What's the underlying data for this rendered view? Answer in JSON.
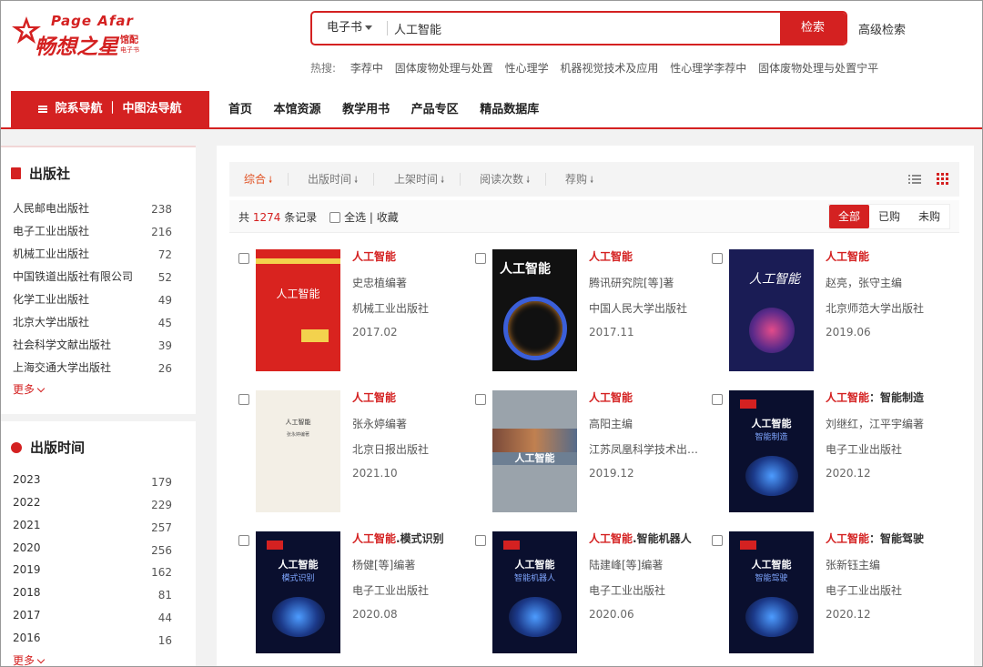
{
  "logo": {
    "brand_en": "Page Afar",
    "brand_cn": "畅想之星",
    "brand_sub_1": "馆配",
    "brand_sub_2": "电子书"
  },
  "search": {
    "category": "电子书",
    "query": "人工智能",
    "button": "检索",
    "advanced": "高级检索"
  },
  "hot": {
    "label": "热搜:",
    "terms": [
      "李荐中",
      "固体废物处理与处置",
      "性心理学",
      "机器视觉技术及应用",
      "性心理学李荐中",
      "固体废物处理与处置宁平"
    ]
  },
  "nav": {
    "category_nav": "院系导航 ｜ 中图法导航",
    "links": [
      "首页",
      "本馆资源",
      "教学用书",
      "产品专区",
      "精品数据库"
    ]
  },
  "publishers": {
    "title": "出版社",
    "items": [
      {
        "name": "人民邮电出版社",
        "count": "238"
      },
      {
        "name": "电子工业出版社",
        "count": "216"
      },
      {
        "name": "机械工业出版社",
        "count": "72"
      },
      {
        "name": "中国铁道出版社有限公司",
        "count": "52"
      },
      {
        "name": "化学工业出版社",
        "count": "49"
      },
      {
        "name": "北京大学出版社",
        "count": "45"
      },
      {
        "name": "社会科学文献出版社",
        "count": "39"
      },
      {
        "name": "上海交通大学出版社",
        "count": "26"
      }
    ],
    "more": "更多"
  },
  "years": {
    "title": "出版时间",
    "items": [
      {
        "name": "2023",
        "count": "179"
      },
      {
        "name": "2022",
        "count": "229"
      },
      {
        "name": "2021",
        "count": "257"
      },
      {
        "name": "2020",
        "count": "256"
      },
      {
        "name": "2019",
        "count": "162"
      },
      {
        "name": "2018",
        "count": "81"
      },
      {
        "name": "2017",
        "count": "44"
      },
      {
        "name": "2016",
        "count": "16"
      }
    ],
    "more": "更多"
  },
  "sort": {
    "items": [
      "综合",
      "出版时间",
      "上架时间",
      "阅读次数",
      "荐购"
    ]
  },
  "summary": {
    "prefix": "共",
    "count": "1274",
    "suffix": "条记录",
    "select_all": "全选 | 收藏"
  },
  "filter_tabs": [
    "全部",
    "已购",
    "未购"
  ],
  "books": [
    {
      "title": "人工智能",
      "title_rest": "",
      "author": "史忠植编著",
      "publisher": "机械工业出版社",
      "date": "2017.02",
      "cover": "red",
      "cover_text": "人工智能"
    },
    {
      "title": "人工智能",
      "title_rest": "",
      "author": "腾讯研究院[等]著",
      "publisher": "中国人民大学出版社",
      "date": "2017.11",
      "cover": "black",
      "cover_text": "人工智能"
    },
    {
      "title": "人工智能",
      "title_rest": "",
      "author": "赵亮，张守主编",
      "publisher": "北京师范大学出版社",
      "date": "2019.06",
      "cover": "navy",
      "cover_text": "人工智能"
    },
    {
      "title": "人工智能",
      "title_rest": "",
      "author": "张永婷编著",
      "publisher": "北京日报出版社",
      "date": "2021.10",
      "cover": "cream",
      "cover_text": "人工智能"
    },
    {
      "title": "人工智能",
      "title_rest": "",
      "author": "高阳主编",
      "publisher": "江苏凤凰科学技术出版社",
      "date": "2019.12",
      "cover": "grey",
      "cover_text": "人工智能"
    },
    {
      "title": "人工智能",
      "title_rest": "：智能制造",
      "author": "刘继红，江平宇编著",
      "publisher": "电子工业出版社",
      "date": "2020.12",
      "cover": "dark",
      "cover_text": "人工智能",
      "cover_sub": "智能制造"
    },
    {
      "title": "人工智能",
      "title_rest": ".模式识别",
      "author": "杨健[等]编著",
      "publisher": "电子工业出版社",
      "date": "2020.08",
      "cover": "dark",
      "cover_text": "人工智能",
      "cover_sub": "模式识别"
    },
    {
      "title": "人工智能",
      "title_rest": ".智能机器人",
      "author": "陆建峰[等]编著",
      "publisher": "电子工业出版社",
      "date": "2020.06",
      "cover": "dark",
      "cover_text": "人工智能",
      "cover_sub": "智能机器人"
    },
    {
      "title": "人工智能",
      "title_rest": "：智能驾驶",
      "author": "张新钰主编",
      "publisher": "电子工业出版社",
      "date": "2020.12",
      "cover": "dark",
      "cover_text": "人工智能",
      "cover_sub": "智能驾驶"
    }
  ]
}
